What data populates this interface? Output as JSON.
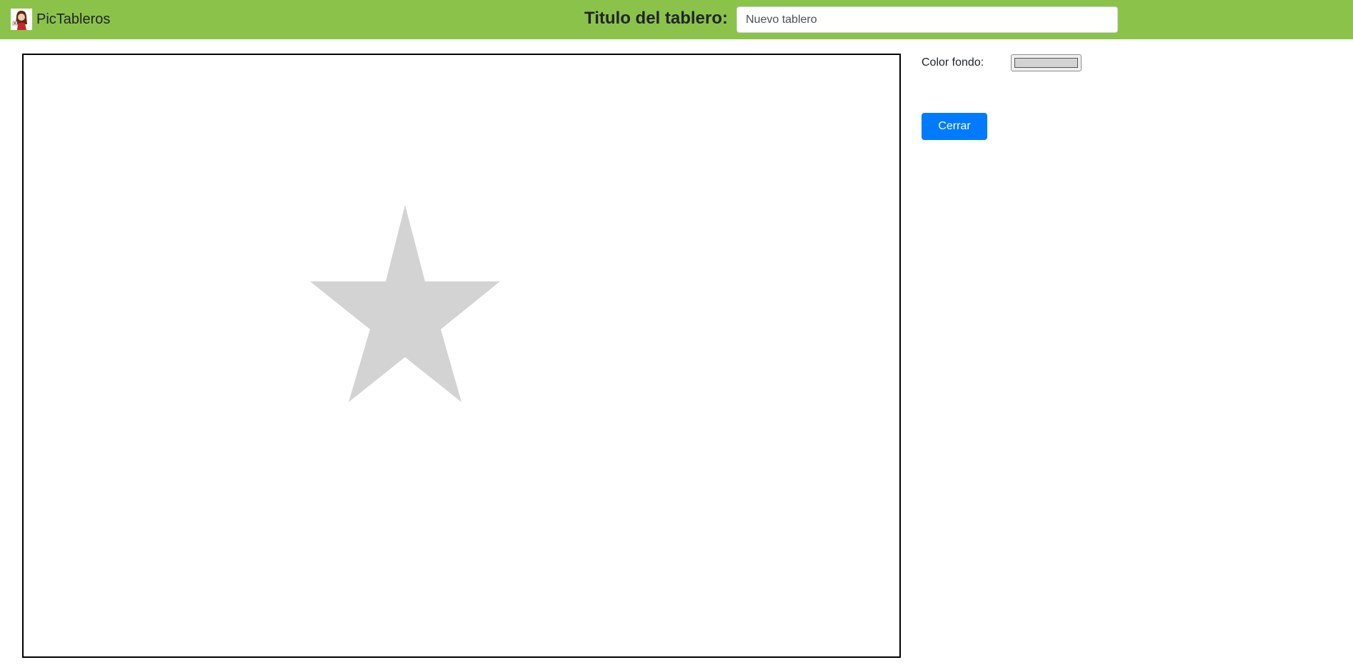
{
  "app": {
    "name": "PicTableros",
    "logo_icon": "girl-avatar-logo-icon"
  },
  "header": {
    "title_label": "Titulo del tablero:",
    "title_input_value": "Nuevo tablero"
  },
  "board": {
    "shape": "star-icon",
    "shape_color": "#d3d3d3",
    "background": "#ffffff"
  },
  "sidebar": {
    "color_label": "Color fondo:",
    "color_value": "#d3d3d3",
    "close_label": "Cerrar"
  },
  "colors": {
    "topbar": "#8bc34a",
    "primary_button": "#007bff"
  }
}
